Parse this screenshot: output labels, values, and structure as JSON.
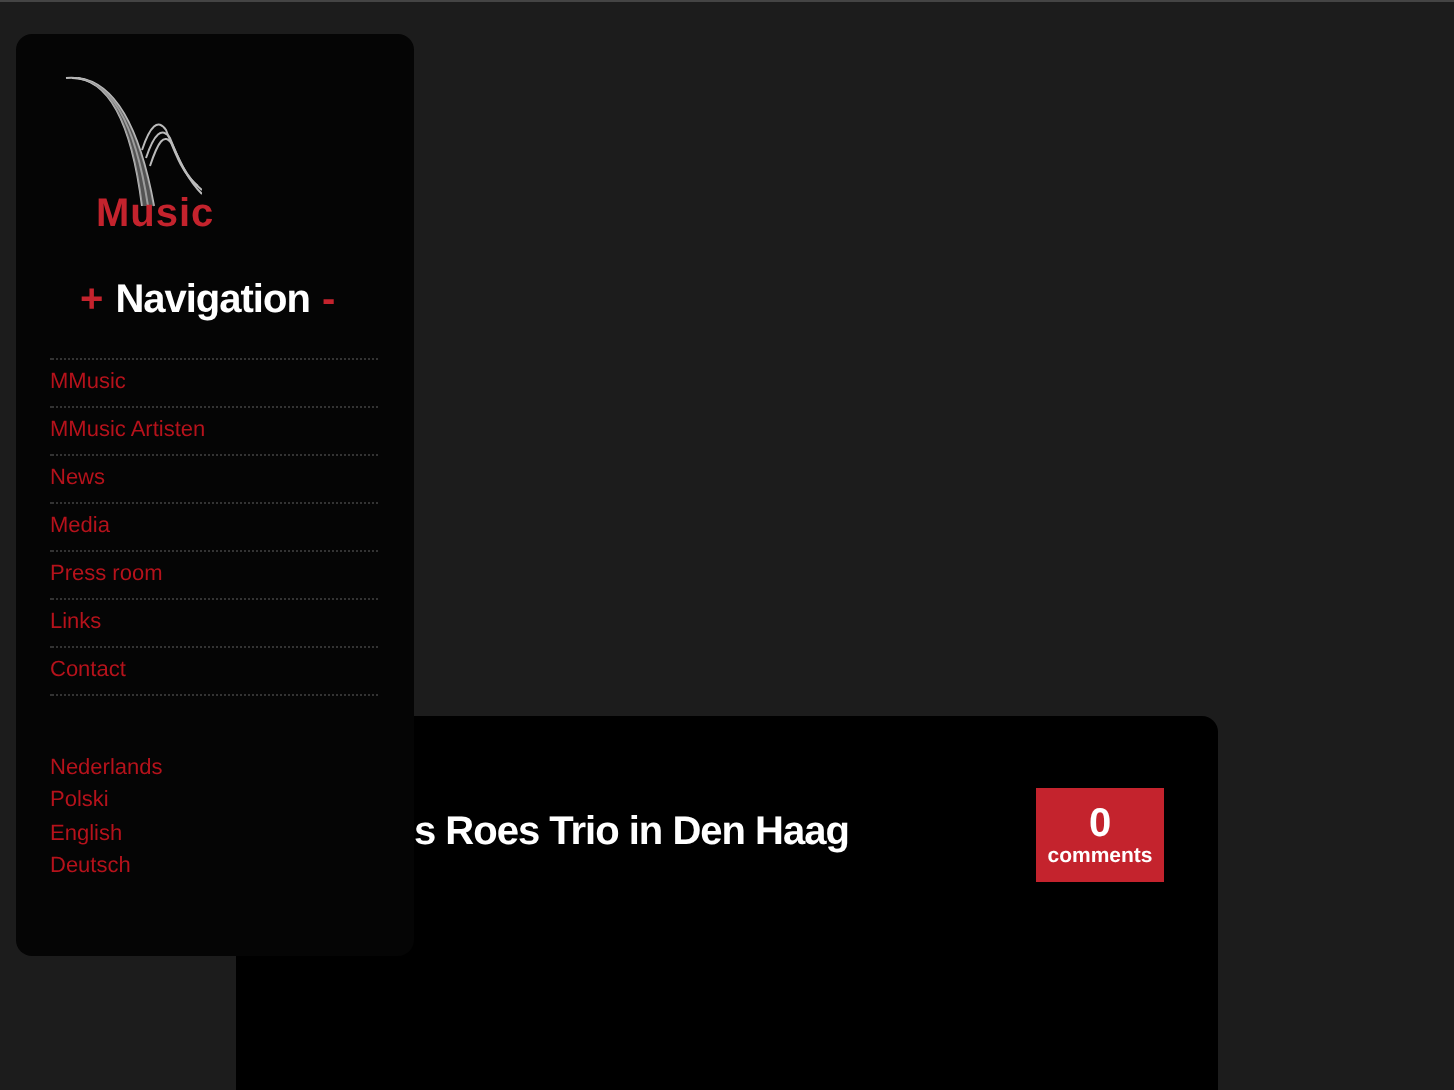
{
  "logo": {
    "text": "Music"
  },
  "navigation": {
    "expand": "+",
    "title": "Navigation",
    "collapse": "-"
  },
  "menu": [
    {
      "label": "MMusic"
    },
    {
      "label": "MMusic Artisten"
    },
    {
      "label": "News"
    },
    {
      "label": "Media"
    },
    {
      "label": "Press room"
    },
    {
      "label": "Links"
    },
    {
      "label": "Contact"
    }
  ],
  "languages": [
    "Nederlands",
    "Polski",
    "English",
    "Deutsch"
  ],
  "post": {
    "title": "s Roes Trio in Den Haag",
    "comments_count": "0",
    "comments_label": "comments"
  }
}
